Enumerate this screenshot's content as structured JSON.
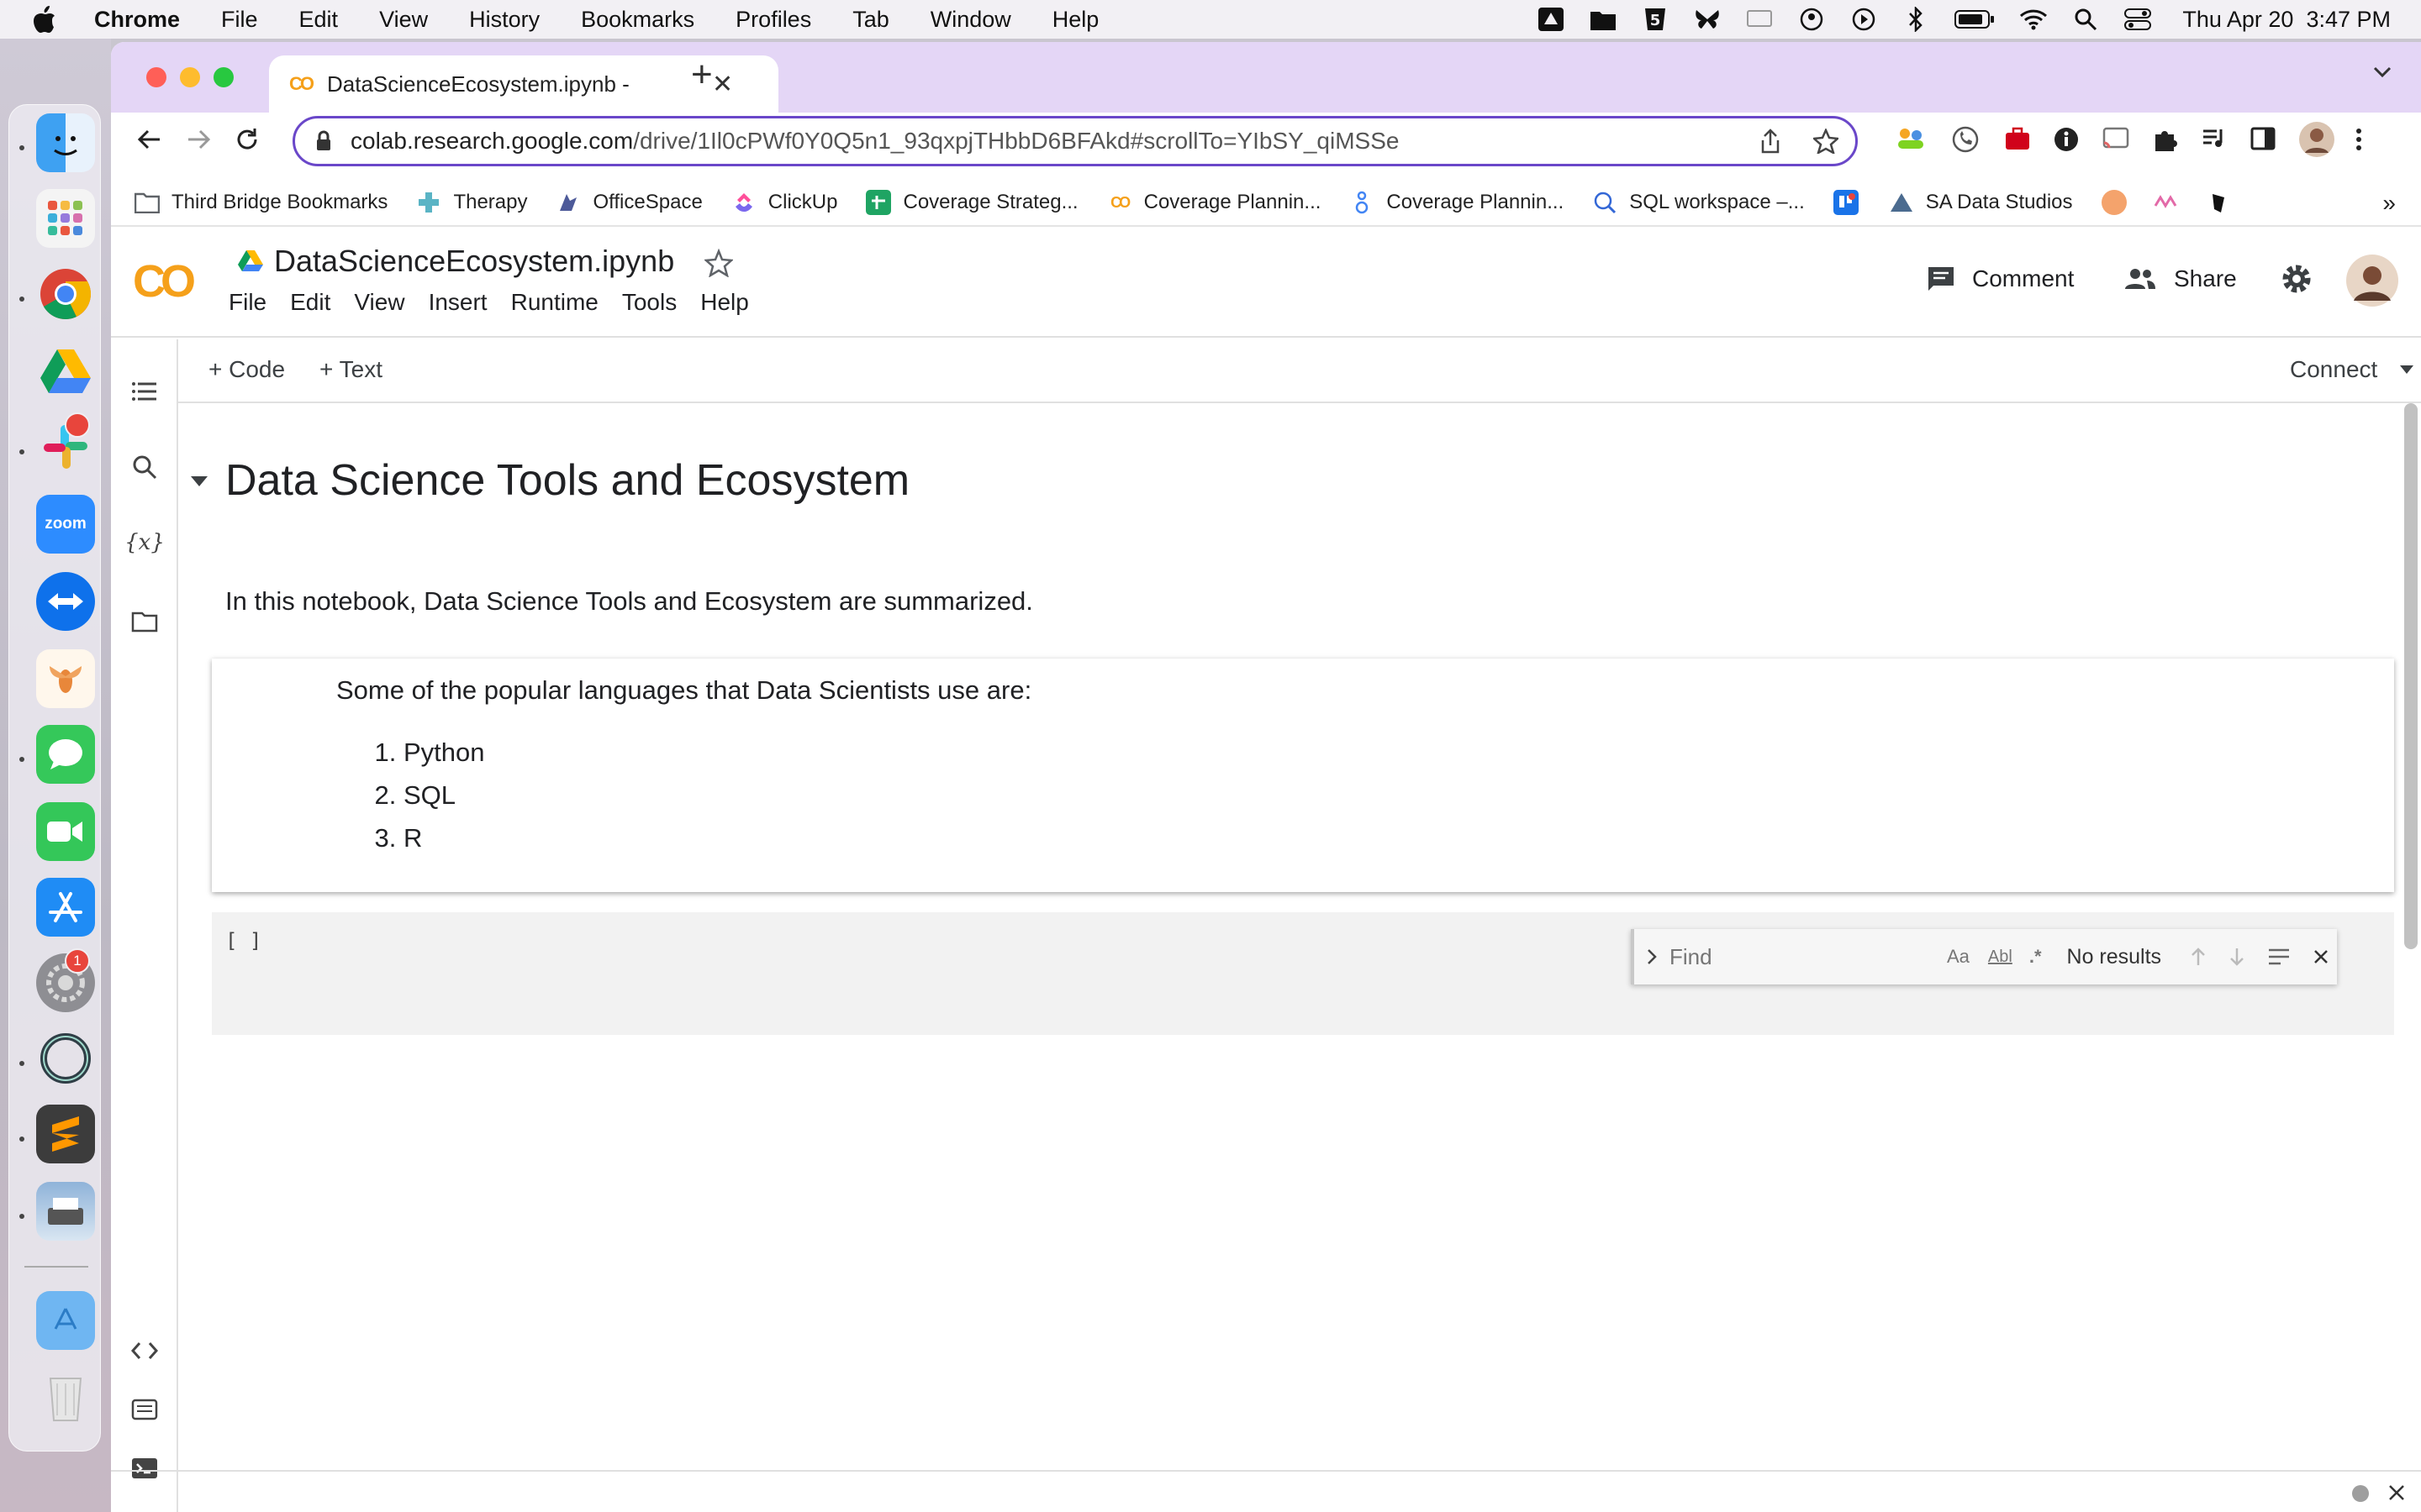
{
  "menubar": {
    "app": "Chrome",
    "items": [
      "File",
      "Edit",
      "View",
      "History",
      "Bookmarks",
      "Profiles",
      "Tab",
      "Window",
      "Help"
    ],
    "clock": "Thu Apr 20  3:47 PM"
  },
  "dock": {
    "badges": {
      "slack": "",
      "settings": "1"
    },
    "zoom_label": "zoom"
  },
  "browser": {
    "tab_title": "DataScienceEcosystem.ipynb - ",
    "url_host": "colab.research.google.com",
    "url_path": "/drive/1Il0cPWf0Y0Q5n1_93qxpjTHbbD6BFAkd#scrollTo=YIbSY_qiMSSe",
    "bookmarks": [
      {
        "label": "Third Bridge Bookmarks",
        "icon": "folder-icon",
        "color": "#5f6368"
      },
      {
        "label": "Therapy",
        "icon": "plus-cross-icon",
        "color": "#5ab4c5"
      },
      {
        "label": "OfficeSpace",
        "icon": "office-icon",
        "color": "#4d5a99"
      },
      {
        "label": "ClickUp",
        "icon": "clickup-icon",
        "color": "#7b68ee"
      },
      {
        "label": "Coverage Strateg...",
        "icon": "sheets-icon",
        "color": "#1fa463"
      },
      {
        "label": "Coverage Plannin...",
        "icon": "colab-icon",
        "color": "#f5a01a"
      },
      {
        "label": "Coverage Plannin...",
        "icon": "person-icon",
        "color": "#4285f4"
      },
      {
        "label": "SQL workspace –...",
        "icon": "sql-icon",
        "color": "#3367d6"
      },
      {
        "label": "",
        "icon": "trello-icon",
        "color": "#1a73e8"
      },
      {
        "label": "SA Data Studios",
        "icon": "datastudio-icon",
        "color": "#4b6b8f"
      }
    ]
  },
  "colab": {
    "notebook_title": "DataScienceEcosystem.ipynb",
    "menu": [
      "File",
      "Edit",
      "View",
      "Insert",
      "Runtime",
      "Tools",
      "Help"
    ],
    "comment_label": "Comment",
    "share_label": "Share",
    "add_code_label": "Code",
    "add_text_label": "Text",
    "connect_label": "Connect",
    "heading": "Data Science Tools and Ecosystem",
    "intro": "In this notebook, Data Science Tools and Ecosystem are summarized.",
    "languages_lead": "Some of the popular languages that Data Scientists use are:",
    "languages": [
      "Python",
      "SQL",
      "R"
    ],
    "code_prompt": "[ ]",
    "find": {
      "placeholder": "Find",
      "result": "No results",
      "case": "Aa",
      "word": "Abl",
      "regex": ".*"
    }
  },
  "colors": {
    "tabstrip": "#e4d6f6",
    "omnibox_focus": "#6a47c9",
    "colab_orange": "#f5a01a"
  }
}
